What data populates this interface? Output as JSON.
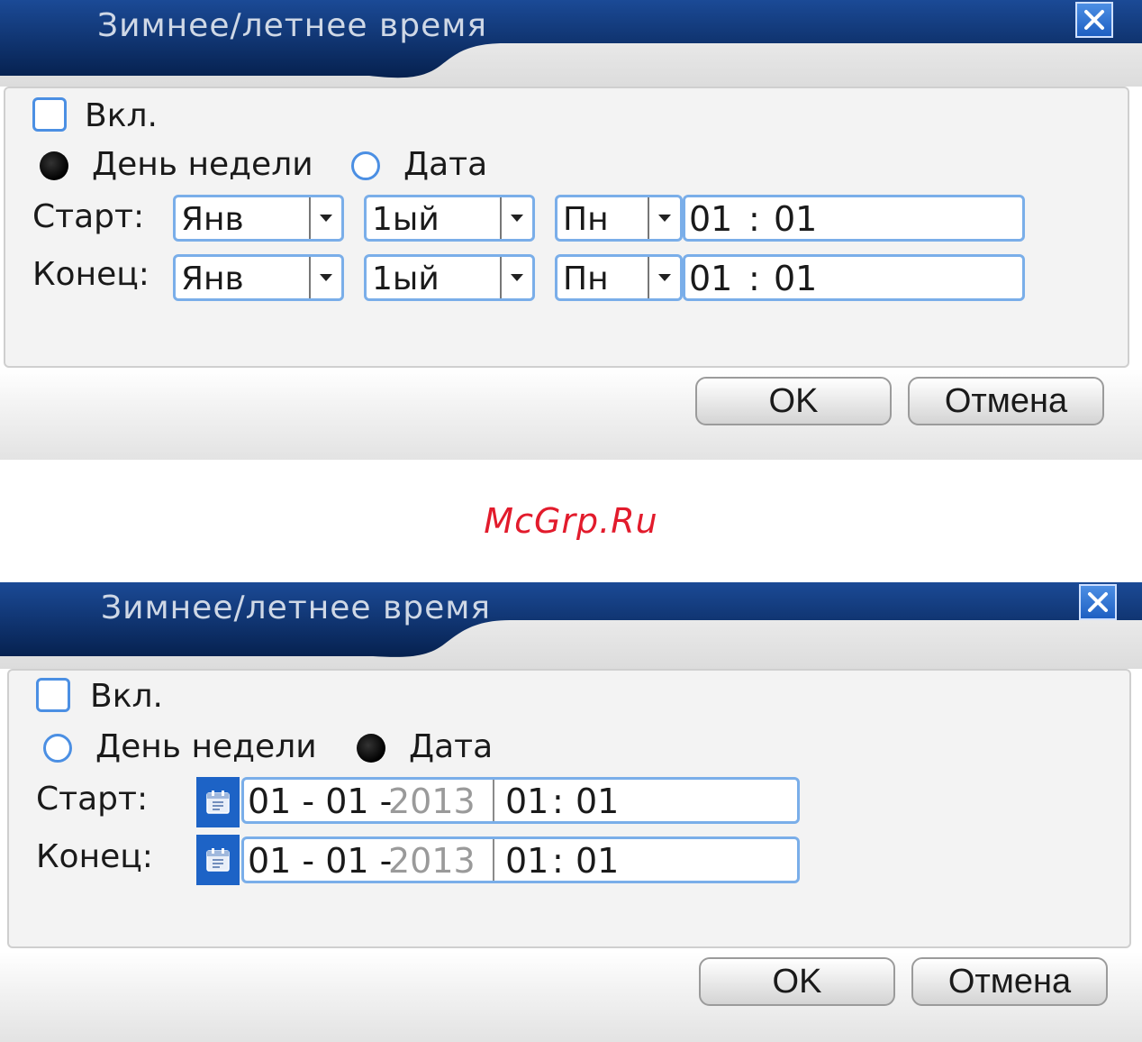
{
  "colors": {
    "title_bar": "#0a2d6b",
    "accent": "#4b8fe3",
    "close_button": "#2f74d6",
    "watermark": "#e21b2c"
  },
  "dialog_weekday": {
    "title": "Зимнее/летнее время",
    "close_icon": "close-icon",
    "enable_label": "Вкл.",
    "enable_checked": false,
    "mode_weekday_label": "День недели",
    "mode_date_label": "Дата",
    "selected_mode": "weekday",
    "start": {
      "label": "Старт:",
      "month": "Янв",
      "week": "1ый",
      "day": "Пн",
      "hour": "01",
      "sep": ":",
      "minute": "01"
    },
    "end": {
      "label": "Конец:",
      "month": "Янв",
      "week": "1ый",
      "day": "Пн",
      "hour": "01",
      "sep": ":",
      "minute": "01"
    },
    "ok_label": "OK",
    "cancel_label": "Отмена"
  },
  "watermark": "McGrp.Ru",
  "dialog_date": {
    "title": "Зимнее/летнее время",
    "close_icon": "close-icon",
    "enable_label": "Вкл.",
    "enable_checked": false,
    "mode_weekday_label": "День недели",
    "mode_date_label": "Дата",
    "selected_mode": "date",
    "start": {
      "label": "Старт:",
      "calendar_icon": "calendar-icon",
      "date_prefix": "01 - 01 -",
      "year": "2013",
      "hour": "01",
      "sep": ":",
      "minute": "01"
    },
    "end": {
      "label": "Конец:",
      "calendar_icon": "calendar-icon",
      "date_prefix": "01 - 01 -",
      "year": "2013",
      "hour": "01",
      "sep": ":",
      "minute": "01"
    },
    "ok_label": "OK",
    "cancel_label": "Отмена"
  }
}
